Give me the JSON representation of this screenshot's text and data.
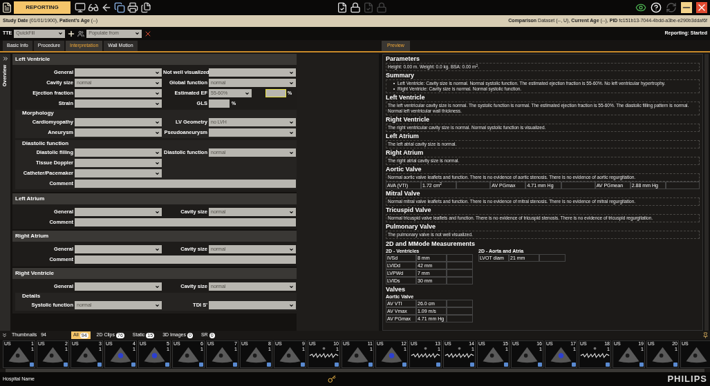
{
  "toolbar": {
    "title": "REPORTING",
    "center_tools": [
      {
        "disabled": false
      },
      {
        "disabled": false
      },
      {
        "disabled": true
      },
      {
        "disabled": true
      }
    ],
    "refresh_disabled": true
  },
  "info_bar": {
    "left": "**Study Date** (01/01/1900), **Patient's Age** (--)",
    "right": "**Comparison** Dataset (--, U), **Current Age** (--), **PID** fc151b13-7044-4bdd-a3be-e290b3ddaf6f"
  },
  "form_toolbar": {
    "type": "TTE",
    "quickfill_placeholder": "QuickFill",
    "populate_placeholder": "Populate from",
    "status": "Reporting: Started"
  },
  "tabs": [
    {
      "label": "Basic Info",
      "selected": false
    },
    {
      "label": "Procedure",
      "selected": false
    },
    {
      "label": "Interpretation",
      "selected": true
    },
    {
      "label": "Wall Motion",
      "selected": false
    }
  ],
  "overview_label": "Overview",
  "sections": [
    {
      "title": "Left Ventricle",
      "items": [
        {
          "kind": "row",
          "fields": [
            {
              "kind": "select",
              "label": "General"
            },
            {
              "kind": "select",
              "label": "Not well visualized"
            }
          ]
        },
        {
          "kind": "row",
          "fields": [
            {
              "kind": "select",
              "label": "Cavity size",
              "value": "normal"
            },
            {
              "kind": "select",
              "label": "Global function",
              "value": "normal"
            }
          ]
        },
        {
          "kind": "row",
          "fields": [
            {
              "kind": "select",
              "label": "Ejection fraction"
            },
            {
              "kind": "ef",
              "label": "Estimated EF",
              "value": "55-60%",
              "unit": "%",
              "focused": true
            }
          ]
        },
        {
          "kind": "row",
          "fields": [
            {
              "kind": "select",
              "label": "Strain"
            },
            {
              "kind": "number",
              "label": "GLS",
              "unit": "%",
              "focused": false
            }
          ]
        },
        {
          "kind": "group",
          "title": "Morphology",
          "items": [
            {
              "kind": "row",
              "fields": [
                {
                  "kind": "select",
                  "label": "Cardiomyopathy"
                },
                {
                  "kind": "select",
                  "label": "LV Geometry",
                  "value": "no LVH"
                }
              ]
            },
            {
              "kind": "row",
              "fields": [
                {
                  "kind": "select",
                  "label": "Aneurysm"
                },
                {
                  "kind": "select",
                  "label": "Pseudoaneurysm"
                }
              ]
            }
          ]
        },
        {
          "kind": "group",
          "title": "Diastolic function",
          "items": [
            {
              "kind": "row",
              "fields": [
                {
                  "kind": "select",
                  "label": "Diastolic filling"
                },
                {
                  "kind": "select",
                  "label": "Diastolic function",
                  "value": "normal"
                }
              ]
            },
            {
              "kind": "row",
              "fields": [
                {
                  "kind": "select",
                  "label": "Tissue Doppler"
                }
              ]
            },
            {
              "kind": "row",
              "fields": [
                {
                  "kind": "select",
                  "label": "Catheter/Pacemaker"
                }
              ]
            },
            {
              "kind": "row",
              "fields": [
                {
                  "kind": "comment",
                  "label": "Comment"
                }
              ]
            }
          ]
        }
      ]
    },
    {
      "title": "Left Atrium",
      "items": [
        {
          "kind": "row",
          "fields": [
            {
              "kind": "select",
              "label": "General"
            },
            {
              "kind": "select",
              "label": "Cavity size",
              "value": "normal"
            }
          ]
        },
        {
          "kind": "row",
          "fields": [
            {
              "kind": "comment",
              "label": "Comment"
            }
          ]
        }
      ]
    },
    {
      "title": "Right Atrium",
      "items": [
        {
          "kind": "row",
          "fields": [
            {
              "kind": "select",
              "label": "General"
            },
            {
              "kind": "select",
              "label": "Cavity size",
              "value": "normal"
            }
          ]
        },
        {
          "kind": "row",
          "fields": [
            {
              "kind": "comment",
              "label": "Comment"
            }
          ]
        }
      ]
    },
    {
      "title": "Right Ventricle",
      "items": [
        {
          "kind": "row",
          "fields": [
            {
              "kind": "select",
              "label": "General"
            },
            {
              "kind": "select",
              "label": "Cavity size",
              "value": "normal"
            }
          ]
        },
        {
          "kind": "group",
          "title": "Details",
          "items": [
            {
              "kind": "row",
              "fields": [
                {
                  "kind": "select",
                  "label": "Systolic function",
                  "value": "normal"
                },
                {
                  "kind": "select",
                  "label": "TDI S'"
                }
              ]
            }
          ]
        }
      ]
    }
  ],
  "preview": {
    "tab": "Preview",
    "sections": [
      {
        "kind": "text",
        "title": "Parameters",
        "text": "Height: 0.00 m. Weight: 0.0 kg. BSA: 0.00 m$^{2}$."
      },
      {
        "kind": "bullets",
        "title": "Summary",
        "bullets": [
          "Left Ventricle: Cavity size is normal. Normal systolic function. The estimated ejection fraction is 55-60%. No left ventricular hypertrophy.",
          "Right Ventricle: Cavity size is normal. Normal systolic function."
        ]
      },
      {
        "kind": "text",
        "title": "Left Ventricle",
        "text": "The left ventricular cavity size is normal. The systolic function is normal. The estimated ejection fraction is 55-60%. The diastolic filling pattern is normal. Normal left ventricular wall thickness."
      },
      {
        "kind": "text",
        "title": "Right Ventricle",
        "text": "The right ventricular cavity size is normal. Normal systolic function is visualized."
      },
      {
        "kind": "text",
        "title": "Left Atrium",
        "text": "The left atrial cavity size is normal."
      },
      {
        "kind": "text",
        "title": "Right Atrium",
        "text": "The right atrial cavity size is normal."
      },
      {
        "kind": "text_measures",
        "title": "Aortic Valve",
        "text": "Normal aortic valve leaflets and function. There is no evidence of aortic stenosis. There is no evidence of aortic regurgitation.",
        "measures": [
          {
            "name": "AVA (VTI)",
            "value": "1.72 cm$^{2}$"
          },
          {
            "name": "AV PGmax",
            "value": "4.71 mm Hg"
          },
          {
            "name": "AV PGmean",
            "value": "2.88 mm Hg"
          }
        ]
      },
      {
        "kind": "text",
        "title": "Mitral Valve",
        "text": "Normal mitral valve leaflets and function. There is no evidence of mitral stenosis. There is no evidence of mitral regurgitation."
      },
      {
        "kind": "text",
        "title": "Tricuspid Valve",
        "text": "Normal tricuspid valve leaflets and function. There is no evidence of tricuspid stenosis. There is no evidence of tricuspid regurgitation."
      },
      {
        "kind": "text",
        "title": "Pulmonary Valve",
        "text": "The pulmonary valve is not well visualized."
      },
      {
        "kind": "tables",
        "title": "2D and MMode Measurements",
        "tables": [
          {
            "title": "2D - Ventricles",
            "rows": [
              {
                "name": "IVSd",
                "value": "8 mm"
              },
              {
                "name": "LVIDd",
                "value": "42 mm"
              },
              {
                "name": "LVPWd",
                "value": "7 mm"
              },
              {
                "name": "LVIDs",
                "value": "30 mm"
              }
            ]
          },
          {
            "title": "2D - Aorta and Atria",
            "rows": [
              {
                "name": "LVOT diam",
                "value": "21 mm"
              }
            ]
          }
        ]
      },
      {
        "kind": "tables",
        "title": "Valves",
        "tables": [
          {
            "title": "Aortic Valve",
            "rows": [
              {
                "name": "AV VTI",
                "value": "26.0 cm"
              },
              {
                "name": "AV Vmax",
                "value": "1.09 m/s"
              },
              {
                "name": "AV PGmax",
                "value": "4.71 mm Hg"
              }
            ]
          }
        ]
      }
    ]
  },
  "thumbnails": {
    "label": "Thumbnails",
    "count": "94",
    "filters": [
      {
        "label": "All",
        "count": "94",
        "selected": true
      },
      {
        "label": "2D Clips",
        "count": "76",
        "selected": false
      },
      {
        "label": "Static",
        "count": "15",
        "selected": false
      },
      {
        "label": "3D Images",
        "count": "0",
        "selected": false
      },
      {
        "label": "SR",
        "count": "0",
        "selected": false
      }
    ],
    "items": [
      {
        "modality": "US",
        "number": "1",
        "frames": "1",
        "kind": "echo"
      },
      {
        "modality": "US",
        "number": "2",
        "frames": "1",
        "kind": "echo"
      },
      {
        "modality": "US",
        "number": "3",
        "frames": "1",
        "kind": "echo"
      },
      {
        "modality": "US",
        "number": "4",
        "frames": "1",
        "kind": "color"
      },
      {
        "modality": "US",
        "number": "5",
        "frames": "1",
        "kind": "color"
      },
      {
        "modality": "US",
        "number": "6",
        "frames": "1",
        "kind": "echo"
      },
      {
        "modality": "US",
        "number": "7",
        "frames": "1",
        "kind": "echo"
      },
      {
        "modality": "US",
        "number": "8",
        "frames": "1",
        "kind": "echo"
      },
      {
        "modality": "US",
        "number": "9",
        "frames": "1",
        "kind": "echo"
      },
      {
        "modality": "US",
        "number": "10",
        "frames": "1",
        "kind": "doppler"
      },
      {
        "modality": "US",
        "number": "11",
        "frames": "1",
        "kind": "echo"
      },
      {
        "modality": "US",
        "number": "12",
        "frames": "1",
        "kind": "color"
      },
      {
        "modality": "US",
        "number": "13",
        "frames": "1",
        "kind": "doppler"
      },
      {
        "modality": "US",
        "number": "14",
        "frames": "1",
        "kind": "doppler"
      },
      {
        "modality": "US",
        "number": "15",
        "frames": "1",
        "kind": "echo"
      },
      {
        "modality": "US",
        "number": "16",
        "frames": "1",
        "kind": "echo"
      },
      {
        "modality": "US",
        "number": "17",
        "frames": "1",
        "kind": "color"
      },
      {
        "modality": "US",
        "number": "18",
        "frames": "1",
        "kind": "doppler"
      },
      {
        "modality": "US",
        "number": "19",
        "frames": "1",
        "kind": "echo"
      },
      {
        "modality": "US",
        "number": "20",
        "frames": "1",
        "kind": "echo"
      },
      {
        "modality": "US",
        "kind": "echo"
      }
    ]
  },
  "footer": {
    "hospital": "Hospital Name",
    "brand": "PHILIPS"
  }
}
